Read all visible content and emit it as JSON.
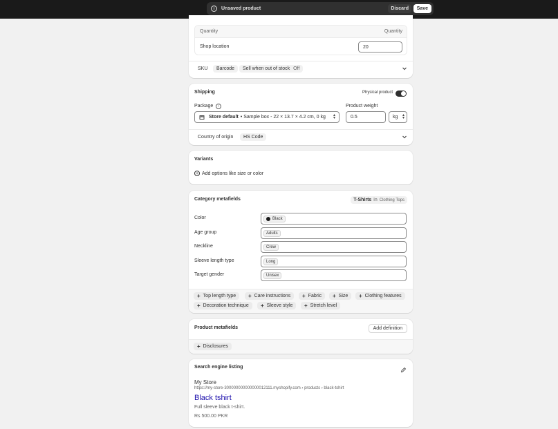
{
  "topbar": {
    "status_title": "Unsaved product",
    "discard_label": "Discard",
    "save_label": "Save"
  },
  "inventory": {
    "col_left": "Quantity",
    "col_right": "Quantity",
    "location_label": "Shop location",
    "quantity_value": "20",
    "sku_label": "SKU",
    "barcode_label": "Barcode",
    "sell_oos_label": "Sell when out of stock",
    "sell_oos_value": "Off"
  },
  "shipping": {
    "title": "Shipping",
    "physical_label": "Physical product",
    "package_label": "Package",
    "package_value_bold": "Store default",
    "package_value_rest": "• Sample box - 22 × 13.7 × 4.2 cm, 0 kg",
    "weight_label": "Product weight",
    "weight_value": "0.5",
    "weight_unit": "kg",
    "origin_label": "Country of origin",
    "hs_label": "HS Code"
  },
  "variants": {
    "title": "Variants",
    "add_options_label": "Add options like size or color"
  },
  "category_metafields": {
    "title": "Category metafields",
    "category_name": "T-Shirts",
    "category_in": "in",
    "category_path": "Clothing Tops",
    "rows": [
      {
        "label": "Color",
        "value": "Black",
        "swatch": "#1a1a1a"
      },
      {
        "label": "Age group",
        "value": "Adults"
      },
      {
        "label": "Neckline",
        "value": "Crew"
      },
      {
        "label": "Sleeve length type",
        "value": "Long"
      },
      {
        "label": "Target gender",
        "value": "Unisex"
      }
    ],
    "add_buttons": [
      "Top length type",
      "Care instructions",
      "Fabric",
      "Size",
      "Clothing features",
      "Decoration technique",
      "Sleeve style",
      "Stretch level"
    ]
  },
  "product_metafields": {
    "title": "Product metafields",
    "add_definition_label": "Add definition",
    "disclosures_label": "Disclosures"
  },
  "seo": {
    "title": "Search engine listing",
    "store_name": "My Store",
    "url": "https://my-store-300000000000000012111.myshopify.com › products › black-tshirt",
    "page_title": "Black tshirt",
    "description": "Full sleeve black t-shirt.",
    "price": "Rs 500.00 PKR"
  }
}
